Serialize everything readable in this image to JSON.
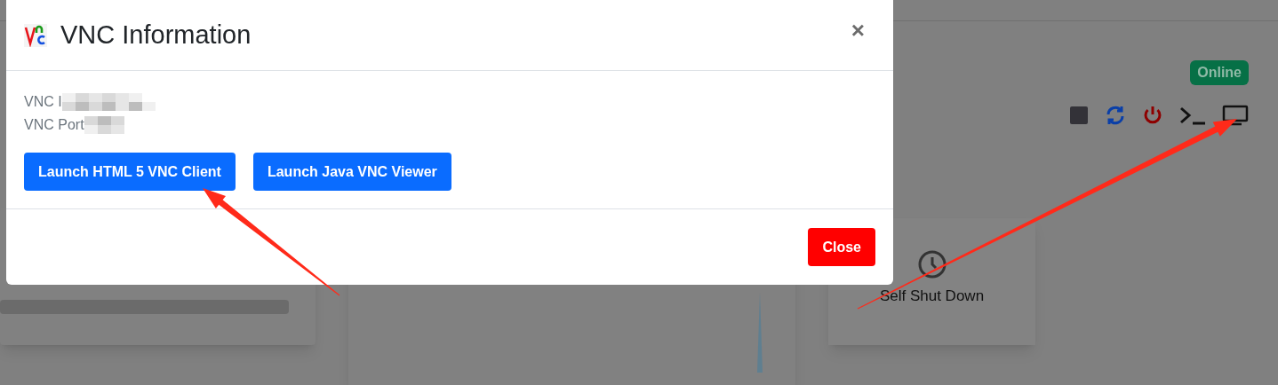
{
  "dialog": {
    "title": "VNC Information",
    "close_icon": "×",
    "fields": [
      {
        "label": "VNC I"
      },
      {
        "label": "VNC Port"
      }
    ],
    "buttons": [
      "Launch HTML 5 VNC Client",
      "Launch Java VNC Viewer"
    ],
    "footer_button": "Close"
  },
  "background": {
    "status_badge": "Online",
    "card": {
      "label": "Self Shut Down"
    }
  }
}
